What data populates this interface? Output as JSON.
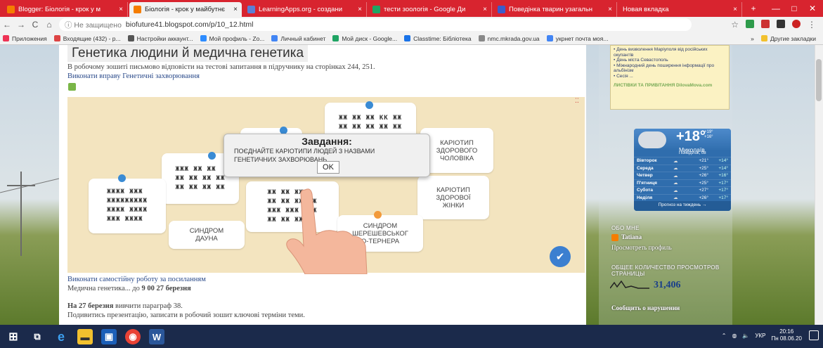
{
  "tabs": [
    {
      "label": "Blogger: Біологія - крок у м",
      "icon": "blogger-icon",
      "color": "#f57d00"
    },
    {
      "label": "Біологія - крок у майбутнє",
      "icon": "blogger-icon",
      "color": "#f57d00"
    },
    {
      "label": "LearningApps.org - создани",
      "icon": "learningapps-icon",
      "color": "#5b7fd6"
    },
    {
      "label": "тести зоологія - Google Ди",
      "icon": "google-drive-icon",
      "color": "#1fa463"
    },
    {
      "label": "Поведінка тварин узагальн",
      "icon": "forms-icon",
      "color": "#3b5ccc"
    },
    {
      "label": "Новая вкладка",
      "icon": "",
      "color": ""
    }
  ],
  "tab_close": "×",
  "new_tab": "+",
  "window_controls": {
    "minimize": "—",
    "maximize": "□",
    "close": "✕"
  },
  "nav": {
    "back": "←",
    "forward": "→",
    "reload": "C",
    "home": "⌂",
    "insecure": "ⓘ Не защищено",
    "url": "biofuture41.blogspot.com/p/10_12.html",
    "star": "☆",
    "menu": "⋮"
  },
  "bookmarks": [
    {
      "label": "Приложения",
      "color": "#e35"
    },
    {
      "label": "Входящие (432) - p...",
      "color": "#d44"
    },
    {
      "label": "Настройки аккаунт...",
      "color": "#555"
    },
    {
      "label": "Мой профиль - Zo...",
      "color": "#2d8cff"
    },
    {
      "label": "Личный кабинет",
      "color": "#4285f4"
    },
    {
      "label": "Мой диск - Google...",
      "color": "#1fa463"
    },
    {
      "label": "Classtime: Біблiотека",
      "color": "#1a73e8"
    },
    {
      "label": "nmc.mkrada.gov.ua",
      "color": "#888"
    },
    {
      "label": "укрнет почта моя...",
      "color": "#4285f4"
    }
  ],
  "bookmarks_more": "»",
  "other_bookmarks": "Другие закладки",
  "page": {
    "title": "Генетика людини й медична генетика",
    "line1": "В робочому зошиті письмово відповісти на тестові запитання в підручнику на сторінках 244, 251.",
    "line2": "Виконати вправу Генетичні захворювання",
    "after1": "Виконати самостійну роботу за посиланням",
    "after2_prefix": "Медична генетика... до ",
    "after2_bold": "9 00 27 березня",
    "after3_bold": "На 27 березня",
    "after3_rest": " вивчити параграф 38.",
    "after4": "Подивитись презентацію, записати в робочий зошит ключові терміни теми."
  },
  "app": {
    "cards": [
      {
        "label": "КАРІОТИП\nЗДОРОВОГО\nЧОЛОВІКА"
      },
      {
        "label": "КАРІОТИП\nЗДОРОВОЇ\nЖІНКИ"
      },
      {
        "label": "СИНДРОМ\nДАУНА"
      },
      {
        "label": "СИНДРОМ\nШЕРЕШЕВСЬКОГ\nО-ТЕРНЕРА"
      }
    ],
    "chrom_rows": [
      "ЖЖ ЖЖ КК ЖЖ ЖЖ",
      "ЖЖ ЖЖ ЖЖ ЖЖ ЖЖ"
    ],
    "dialog": {
      "title": "Завдання:",
      "text": "ПОЄДНАЙТЕ КАРІОТИПИ ЛЮДЕЙ З НАЗВАМИ ГЕНЕТИЧНИХ ЗАХВОРЮВАНЬ",
      "ok": "OK"
    },
    "corner_dots": "⁚⁚"
  },
  "sidebar": {
    "news_lines": [
      "• День визволення Маріуполя від російських окупантів",
      "• День міста Севастополь",
      "• Міжнародний день поширення інформації про альбінізм",
      "• Сесія ..."
    ],
    "news_footer": "ЛИСТІВКИ ТА ПРИВІТАННЯ      DilovaMova.com",
    "weather": {
      "temp": "+18°",
      "sub": "+19°\n+16°",
      "city": "Миколаїв",
      "date": "Понеділок, 08",
      "rows": [
        {
          "day": "Вівторок",
          "hi": "+21°",
          "lo": "+14°"
        },
        {
          "day": "Середа",
          "hi": "+25°",
          "lo": "+14°"
        },
        {
          "day": "Четвер",
          "hi": "+26°",
          "lo": "+16°"
        },
        {
          "day": "П'ятниця",
          "hi": "+25°",
          "lo": "+17°"
        },
        {
          "day": "Субота",
          "hi": "+27°",
          "lo": "+17°"
        },
        {
          "day": "Неділя",
          "hi": "+26°",
          "lo": "+17°"
        }
      ],
      "footer": "Прогноз на тиждень →"
    },
    "about_head": "ОБО МНЕ",
    "author": "Tatiana",
    "profile_link": "Просмотреть профиль",
    "views_head": "ОБЩЕЕ КОЛИЧЕСТВО ПРОСМОТРОВ СТРАНИЦЫ",
    "views": "31,406",
    "report": "Сообщить о нарушении"
  },
  "taskbar": {
    "lang": "УКР",
    "time": "20:16",
    "date": "Пн 08.06.20",
    "apps": [
      {
        "name": "task-view",
        "color": "#1b2a4b",
        "glyph": "⧉"
      },
      {
        "name": "edge",
        "color": "#1b2a4b",
        "glyph": "e"
      },
      {
        "name": "file-explorer",
        "color": "#f2c12e",
        "glyph": "▬"
      },
      {
        "name": "media",
        "color": "#1c5fb8",
        "glyph": "▣"
      },
      {
        "name": "chrome",
        "color": "#e94235",
        "glyph": "◉"
      },
      {
        "name": "word",
        "color": "#2b579a",
        "glyph": "W"
      }
    ]
  }
}
